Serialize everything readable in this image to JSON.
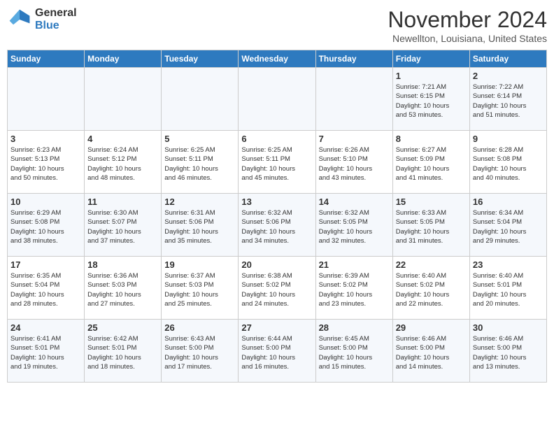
{
  "header": {
    "logo": {
      "general": "General",
      "blue": "Blue"
    },
    "month": "November 2024",
    "location": "Newellton, Louisiana, United States"
  },
  "days_of_week": [
    "Sunday",
    "Monday",
    "Tuesday",
    "Wednesday",
    "Thursday",
    "Friday",
    "Saturday"
  ],
  "weeks": [
    [
      {
        "day": "",
        "info": ""
      },
      {
        "day": "",
        "info": ""
      },
      {
        "day": "",
        "info": ""
      },
      {
        "day": "",
        "info": ""
      },
      {
        "day": "",
        "info": ""
      },
      {
        "day": "1",
        "info": "Sunrise: 7:21 AM\nSunset: 6:15 PM\nDaylight: 10 hours\nand 53 minutes."
      },
      {
        "day": "2",
        "info": "Sunrise: 7:22 AM\nSunset: 6:14 PM\nDaylight: 10 hours\nand 51 minutes."
      }
    ],
    [
      {
        "day": "3",
        "info": "Sunrise: 6:23 AM\nSunset: 5:13 PM\nDaylight: 10 hours\nand 50 minutes."
      },
      {
        "day": "4",
        "info": "Sunrise: 6:24 AM\nSunset: 5:12 PM\nDaylight: 10 hours\nand 48 minutes."
      },
      {
        "day": "5",
        "info": "Sunrise: 6:25 AM\nSunset: 5:11 PM\nDaylight: 10 hours\nand 46 minutes."
      },
      {
        "day": "6",
        "info": "Sunrise: 6:25 AM\nSunset: 5:11 PM\nDaylight: 10 hours\nand 45 minutes."
      },
      {
        "day": "7",
        "info": "Sunrise: 6:26 AM\nSunset: 5:10 PM\nDaylight: 10 hours\nand 43 minutes."
      },
      {
        "day": "8",
        "info": "Sunrise: 6:27 AM\nSunset: 5:09 PM\nDaylight: 10 hours\nand 41 minutes."
      },
      {
        "day": "9",
        "info": "Sunrise: 6:28 AM\nSunset: 5:08 PM\nDaylight: 10 hours\nand 40 minutes."
      }
    ],
    [
      {
        "day": "10",
        "info": "Sunrise: 6:29 AM\nSunset: 5:08 PM\nDaylight: 10 hours\nand 38 minutes."
      },
      {
        "day": "11",
        "info": "Sunrise: 6:30 AM\nSunset: 5:07 PM\nDaylight: 10 hours\nand 37 minutes."
      },
      {
        "day": "12",
        "info": "Sunrise: 6:31 AM\nSunset: 5:06 PM\nDaylight: 10 hours\nand 35 minutes."
      },
      {
        "day": "13",
        "info": "Sunrise: 6:32 AM\nSunset: 5:06 PM\nDaylight: 10 hours\nand 34 minutes."
      },
      {
        "day": "14",
        "info": "Sunrise: 6:32 AM\nSunset: 5:05 PM\nDaylight: 10 hours\nand 32 minutes."
      },
      {
        "day": "15",
        "info": "Sunrise: 6:33 AM\nSunset: 5:05 PM\nDaylight: 10 hours\nand 31 minutes."
      },
      {
        "day": "16",
        "info": "Sunrise: 6:34 AM\nSunset: 5:04 PM\nDaylight: 10 hours\nand 29 minutes."
      }
    ],
    [
      {
        "day": "17",
        "info": "Sunrise: 6:35 AM\nSunset: 5:04 PM\nDaylight: 10 hours\nand 28 minutes."
      },
      {
        "day": "18",
        "info": "Sunrise: 6:36 AM\nSunset: 5:03 PM\nDaylight: 10 hours\nand 27 minutes."
      },
      {
        "day": "19",
        "info": "Sunrise: 6:37 AM\nSunset: 5:03 PM\nDaylight: 10 hours\nand 25 minutes."
      },
      {
        "day": "20",
        "info": "Sunrise: 6:38 AM\nSunset: 5:02 PM\nDaylight: 10 hours\nand 24 minutes."
      },
      {
        "day": "21",
        "info": "Sunrise: 6:39 AM\nSunset: 5:02 PM\nDaylight: 10 hours\nand 23 minutes."
      },
      {
        "day": "22",
        "info": "Sunrise: 6:40 AM\nSunset: 5:02 PM\nDaylight: 10 hours\nand 22 minutes."
      },
      {
        "day": "23",
        "info": "Sunrise: 6:40 AM\nSunset: 5:01 PM\nDaylight: 10 hours\nand 20 minutes."
      }
    ],
    [
      {
        "day": "24",
        "info": "Sunrise: 6:41 AM\nSunset: 5:01 PM\nDaylight: 10 hours\nand 19 minutes."
      },
      {
        "day": "25",
        "info": "Sunrise: 6:42 AM\nSunset: 5:01 PM\nDaylight: 10 hours\nand 18 minutes."
      },
      {
        "day": "26",
        "info": "Sunrise: 6:43 AM\nSunset: 5:00 PM\nDaylight: 10 hours\nand 17 minutes."
      },
      {
        "day": "27",
        "info": "Sunrise: 6:44 AM\nSunset: 5:00 PM\nDaylight: 10 hours\nand 16 minutes."
      },
      {
        "day": "28",
        "info": "Sunrise: 6:45 AM\nSunset: 5:00 PM\nDaylight: 10 hours\nand 15 minutes."
      },
      {
        "day": "29",
        "info": "Sunrise: 6:46 AM\nSunset: 5:00 PM\nDaylight: 10 hours\nand 14 minutes."
      },
      {
        "day": "30",
        "info": "Sunrise: 6:46 AM\nSunset: 5:00 PM\nDaylight: 10 hours\nand 13 minutes."
      }
    ]
  ]
}
